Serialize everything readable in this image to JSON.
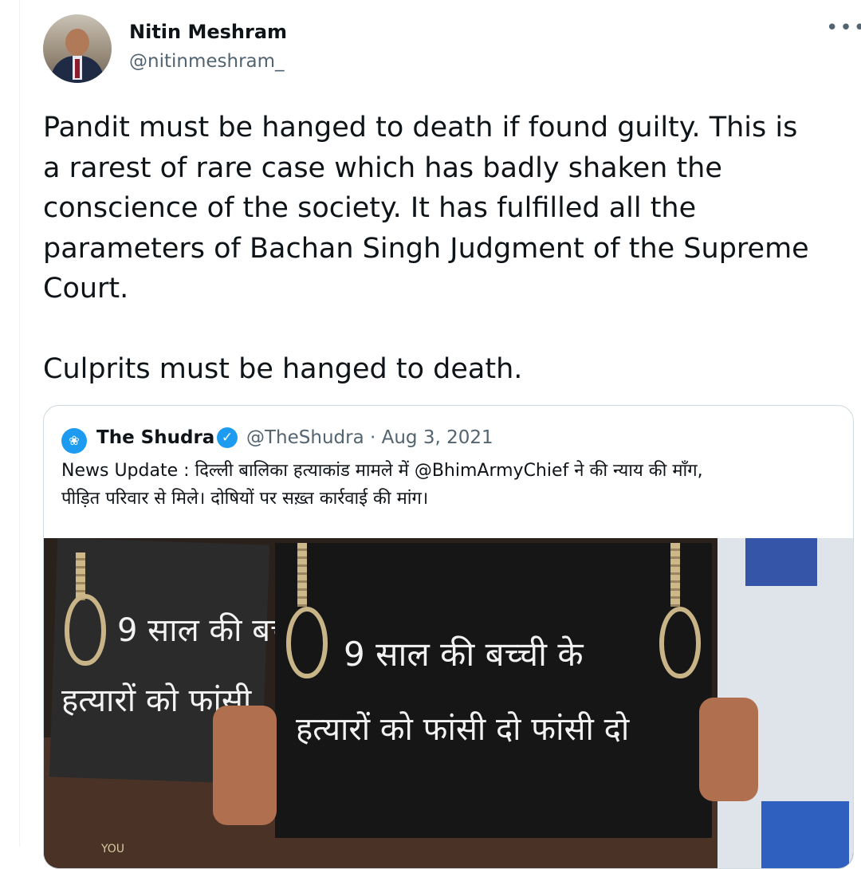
{
  "author": {
    "name": "Nitin Meshram",
    "handle": "@nitinmeshram_",
    "more_label": "•••"
  },
  "tweet": {
    "text": "Pandit must be hanged to death if found guilty. This is\na rarest of rare case which has badly shaken the\nconscience of the society. It has fulfilled all the\nparameters of Bachan Singh Judgment of the Supreme\nCourt.\n\nCulprits must be hanged to death."
  },
  "quoted": {
    "name": "The Shudra",
    "handle": "@TheShudra",
    "separator": "·",
    "date": "Aug 3, 2021",
    "text_line1": "News Update : दिल्ली बालिका हत्याकांड मामले में @BhimArmyChief ने की न्याय की माँग,",
    "text_line2": "पीड़ित परिवार से मिले। दोषियों पर सख़्त कार्रवाई की मांग।",
    "verified_icon": "✓",
    "avatar_glyph": "❀"
  },
  "image": {
    "left_sign_line1": "9 साल की बच",
    "left_sign_line2": "हत्यारों को फांसी",
    "main_sign_line1": "9 साल की बच्ची के",
    "main_sign_line2": "हत्यारों को फांसी दो फांसी दो",
    "corner_text": "YOU"
  },
  "colors": {
    "accent": "#1d9bf0",
    "secondary_text": "#536471",
    "border": "#cfd9de"
  }
}
